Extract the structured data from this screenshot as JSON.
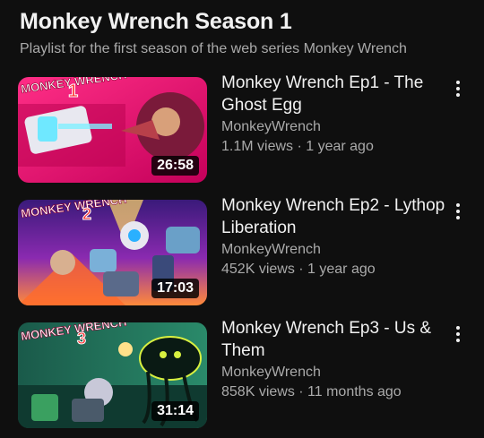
{
  "playlist": {
    "title": "Monkey Wrench Season 1",
    "description": "Playlist for the first season of the web series Monkey Wrench"
  },
  "videos": [
    {
      "title": "Monkey Wrench Ep1 - The Ghost Egg",
      "channel": "MonkeyWrench",
      "meta": "1.1M views · 1 year ago",
      "duration": "26:58",
      "thumb_text": "MONKEY WRENCH",
      "episode_badge": "1"
    },
    {
      "title": "Monkey Wrench Ep2 - Lythop Liberation",
      "channel": "MonkeyWrench",
      "meta": "452K views · 1 year ago",
      "duration": "17:03",
      "thumb_text": "MONKEY WRENCH",
      "episode_badge": "2"
    },
    {
      "title": "Monkey Wrench Ep3 - Us & Them",
      "channel": "MonkeyWrench",
      "meta": "858K views · 11 months ago",
      "duration": "31:14",
      "thumb_text": "MONKEY WRENCH",
      "episode_badge": "3"
    }
  ],
  "icons": {
    "more": "more-vert-icon"
  },
  "colors": {
    "progress": "#ff0000",
    "secondary_text": "#aaaaaa",
    "background": "#0f0f0f"
  }
}
